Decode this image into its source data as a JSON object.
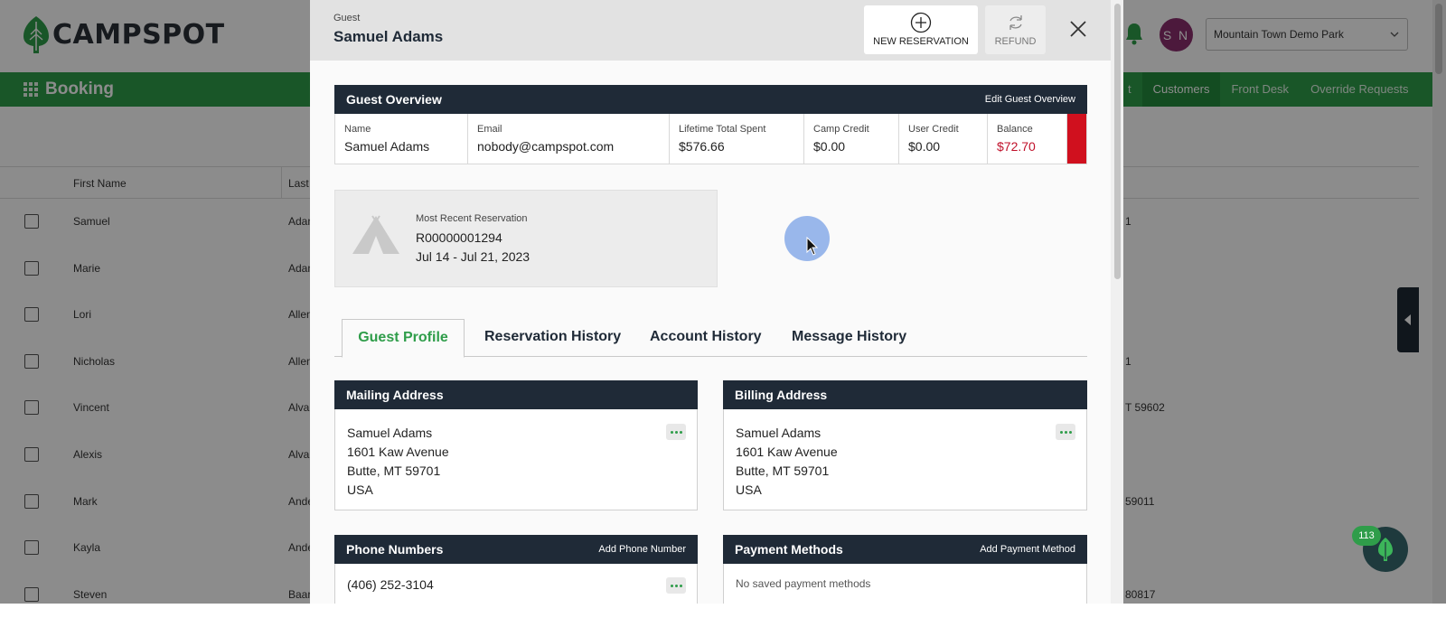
{
  "app": {
    "logo_text": "CAMPSPOT",
    "section_title": "Booking",
    "avatar_initials": "S N",
    "park_select": "Mountain Town Demo Park",
    "nav": [
      "t",
      "Customers",
      "Front Desk",
      "Override Requests"
    ],
    "nav_active": "Customers",
    "table": {
      "headers": [
        "First Name",
        "Last"
      ],
      "rows": [
        {
          "first": "Samuel",
          "last": "Adan",
          "right": "1"
        },
        {
          "first": "Marie",
          "last": "Adan",
          "right": ""
        },
        {
          "first": "Lori",
          "last": "Allen",
          "right": ""
        },
        {
          "first": "Nicholas",
          "last": "Allen",
          "right": "1"
        },
        {
          "first": "Vincent",
          "last": "Alvar",
          "right": "T 59602"
        },
        {
          "first": "Alexis",
          "last": "Alvar",
          "right": ""
        },
        {
          "first": "Mark",
          "last": "Ande",
          "right": "59011"
        },
        {
          "first": "Kayla",
          "last": "Ande",
          "right": ""
        },
        {
          "first": "Steven",
          "last": "Baar",
          "right": "80817"
        }
      ]
    },
    "chat_badge": "113"
  },
  "modal": {
    "header_label": "Guest",
    "guest_name": "Samuel Adams",
    "new_reservation_label": "NEW RESERVATION",
    "refund_label": "REFUND",
    "overview": {
      "title": "Guest Overview",
      "action": "Edit Guest Overview",
      "cells": [
        {
          "label": "Name",
          "value": "Samuel Adams"
        },
        {
          "label": "Email",
          "value": "nobody@campspot.com"
        },
        {
          "label": "Lifetime Total Spent",
          "value": "$576.66"
        },
        {
          "label": "Camp Credit",
          "value": "$0.00"
        },
        {
          "label": "User Credit",
          "value": "$0.00"
        },
        {
          "label": "Balance",
          "value": "$72.70"
        }
      ]
    },
    "recent": {
      "label": "Most Recent Reservation",
      "id": "R00000001294",
      "dates": "Jul 14 - Jul 21, 2023"
    },
    "tabs": [
      "Guest Profile",
      "Reservation History",
      "Account History",
      "Message History"
    ],
    "mailing": {
      "title": "Mailing Address",
      "lines": [
        "Samuel Adams",
        "1601 Kaw Avenue",
        "Butte, MT 59701",
        "USA"
      ]
    },
    "billing": {
      "title": "Billing Address",
      "lines": [
        "Samuel Adams",
        "1601 Kaw Avenue",
        "Butte, MT 59701",
        "USA"
      ]
    },
    "phones": {
      "title": "Phone Numbers",
      "action": "Add Phone Number",
      "items": [
        "(406) 252-3104"
      ]
    },
    "payments": {
      "title": "Payment Methods",
      "action": "Add Payment Method",
      "empty": "No saved payment methods"
    }
  },
  "colors": {
    "brand_green": "#2f9d4a",
    "header_navy": "#1f2a37",
    "balance_red": "#c0102a"
  }
}
